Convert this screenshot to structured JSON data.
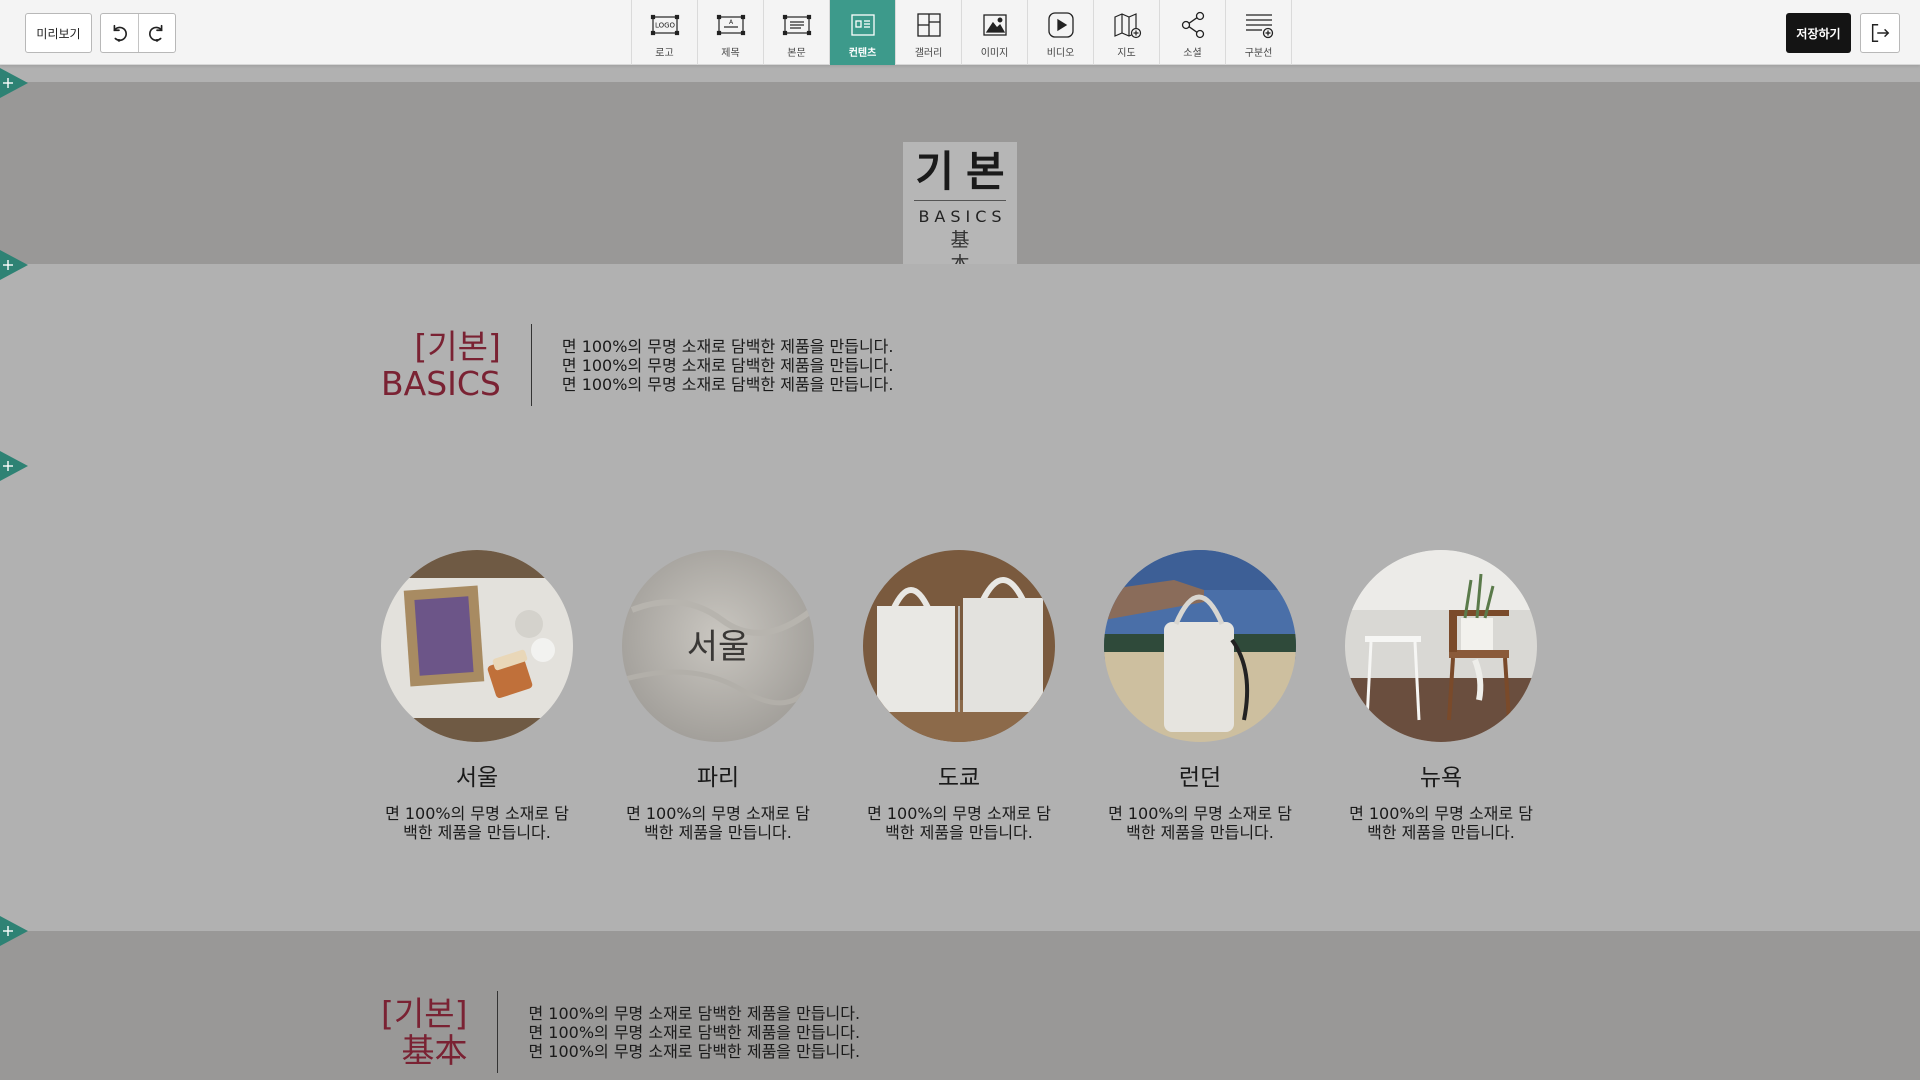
{
  "toolbar": {
    "preview_label": "미리보기",
    "undo_icon": "undo-icon",
    "redo_icon": "redo-icon",
    "tools": [
      {
        "label": "로고",
        "icon": "logo-icon",
        "active": false
      },
      {
        "label": "제목",
        "icon": "title-icon",
        "active": false
      },
      {
        "label": "본문",
        "icon": "body-text-icon",
        "active": false
      },
      {
        "label": "컨텐츠",
        "icon": "contents-icon",
        "active": true
      },
      {
        "label": "갤러리",
        "icon": "gallery-icon",
        "active": false
      },
      {
        "label": "이미지",
        "icon": "image-icon",
        "active": false
      },
      {
        "label": "비디오",
        "icon": "video-icon",
        "active": false
      },
      {
        "label": "지도",
        "icon": "map-icon",
        "active": false
      },
      {
        "label": "소셜",
        "icon": "share-icon",
        "active": false
      },
      {
        "label": "구분선",
        "icon": "divider-add-icon",
        "active": false
      }
    ],
    "save_label": "저장하기",
    "exit_icon": "exit-icon",
    "logo_glyph_text": "LOGO",
    "title_glyph_text": "A"
  },
  "colors": {
    "accent": "#3d9a8b",
    "heading": "#7a2233",
    "band_dark": "#999897",
    "band_light": "#b1b1b1",
    "save_bg": "#141414"
  },
  "logo_block": {
    "main": "기본",
    "english": "BASICS",
    "cjk": "基本"
  },
  "intro": {
    "title_line1": "[기본]",
    "title_line2": "BASICS",
    "lines": [
      "면 100%의 무명 소재로 담백한 제품을 만듭니다.",
      "면 100%의 무명 소재로 담백한 제품을 만듭니다.",
      "면 100%의 무명 소재로 담백한 제품을 만듭니다."
    ]
  },
  "gallery": {
    "items": [
      {
        "title": "서울",
        "text": "면 100%의 무명 소재로 담백한 제품을 만듭니다.",
        "photo": "seoul-photo"
      },
      {
        "title": "파리",
        "text": "면 100%의 무명 소재로 담백한 제품을 만듭니다.",
        "photo": "paris-photo",
        "photo_text": "서울"
      },
      {
        "title": "도쿄",
        "text": "면 100%의 무명 소재로 담백한 제품을 만듭니다.",
        "photo": "tokyo-photo"
      },
      {
        "title": "런던",
        "text": "면 100%의 무명 소재로 담백한 제품을 만듭니다.",
        "photo": "london-photo"
      },
      {
        "title": "뉴욕",
        "text": "면 100%의 무명 소재로 담백한 제품을 만듭니다.",
        "photo": "newyork-photo"
      }
    ]
  },
  "bottom": {
    "title_line1": "[기본]",
    "title_line2": "基本",
    "lines": [
      "면 100%의 무명 소재로 담백한 제품을 만듭니다.",
      "면 100%의 무명 소재로 담백한 제품을 만듭니다.",
      "면 100%의 무명 소재로 담백한 제품을 만듭니다."
    ]
  },
  "add_section_icon": "add-section-icon"
}
